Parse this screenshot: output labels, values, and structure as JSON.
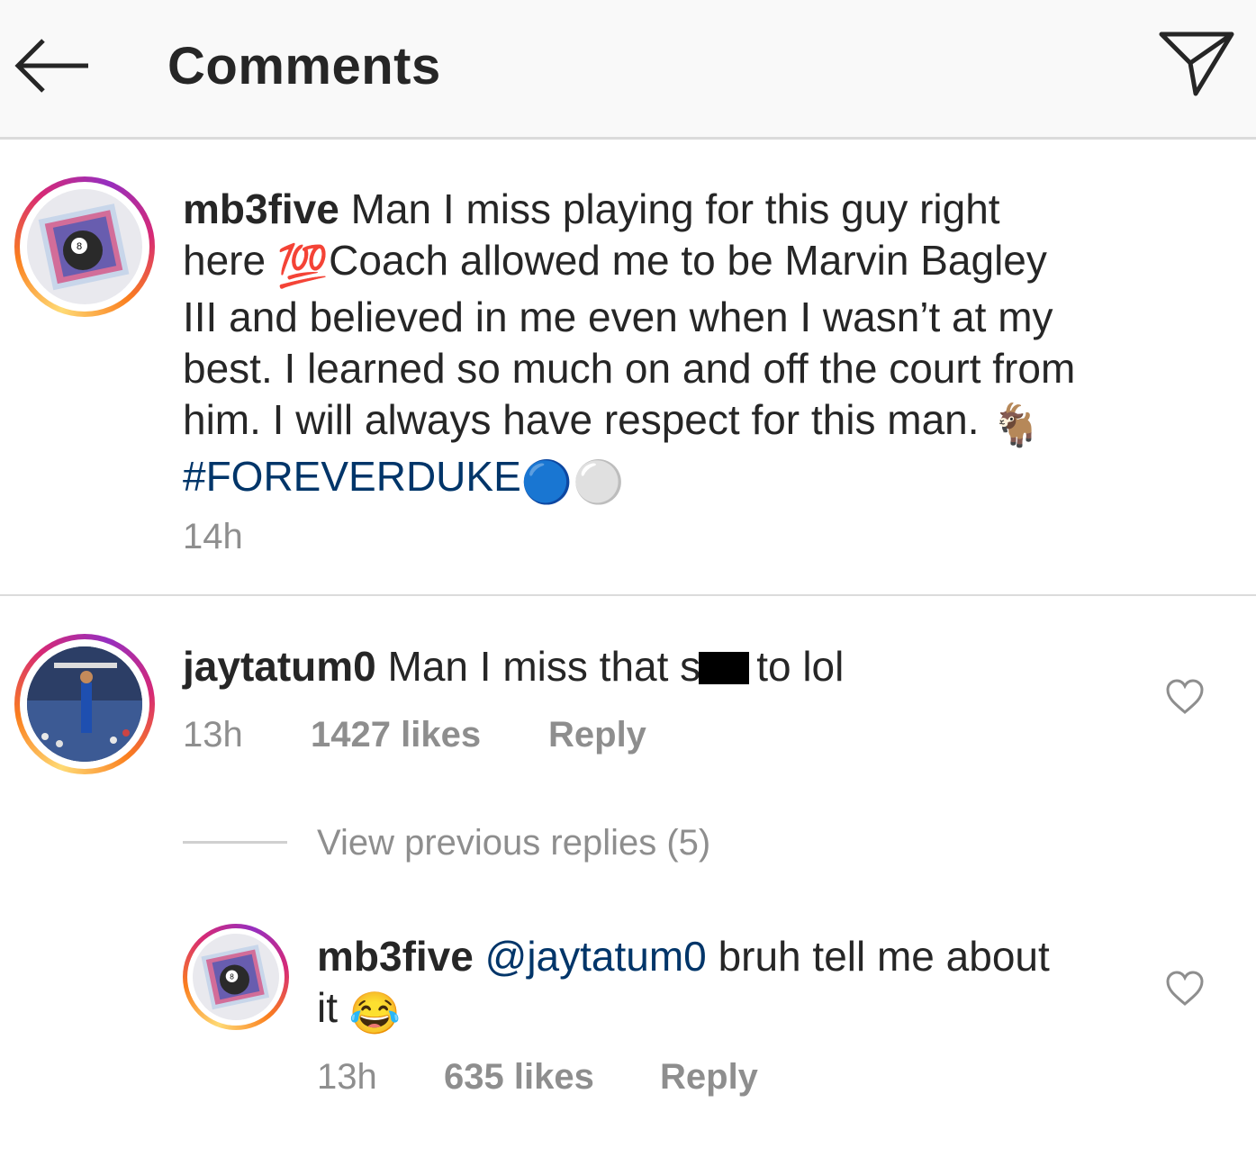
{
  "header": {
    "title": "Comments",
    "back_icon": "arrow-left-icon",
    "send_icon": "paper-plane-icon"
  },
  "caption": {
    "username": "mb3five",
    "text_part1": "Man I miss playing for this guy right",
    "text_part2": "here",
    "emoji_100": "💯",
    "text_part3": "Coach allowed me to be Marvin Bagley",
    "text_part4": "III and believed in me even when I wasn’t at my",
    "text_part5": "best.  I learned so much on and off the court from",
    "text_part6": "him. I will always have respect for this man.",
    "emoji_goat": "🐐",
    "hashtag": "#FOREVERDUKE",
    "emoji_circles": "🔵⚪",
    "time": "14h"
  },
  "comments": [
    {
      "username": "jaytatum0",
      "text_before": "Man I miss that s",
      "text_after": "to lol",
      "time": "13h",
      "likes": "1427 likes",
      "reply_label": "Reply"
    }
  ],
  "view_replies": "View previous replies (5)",
  "reply": {
    "username": "mb3five",
    "mention": "@jaytatum0",
    "text_line1": "bruh tell me about",
    "text_line2": "it",
    "emoji": "😂",
    "time": "13h",
    "likes": "635 likes",
    "reply_label": "Reply"
  },
  "colors": {
    "hashtag": "#003569",
    "meta": "#8e8e8e",
    "header_bg": "#f9f9f9"
  }
}
